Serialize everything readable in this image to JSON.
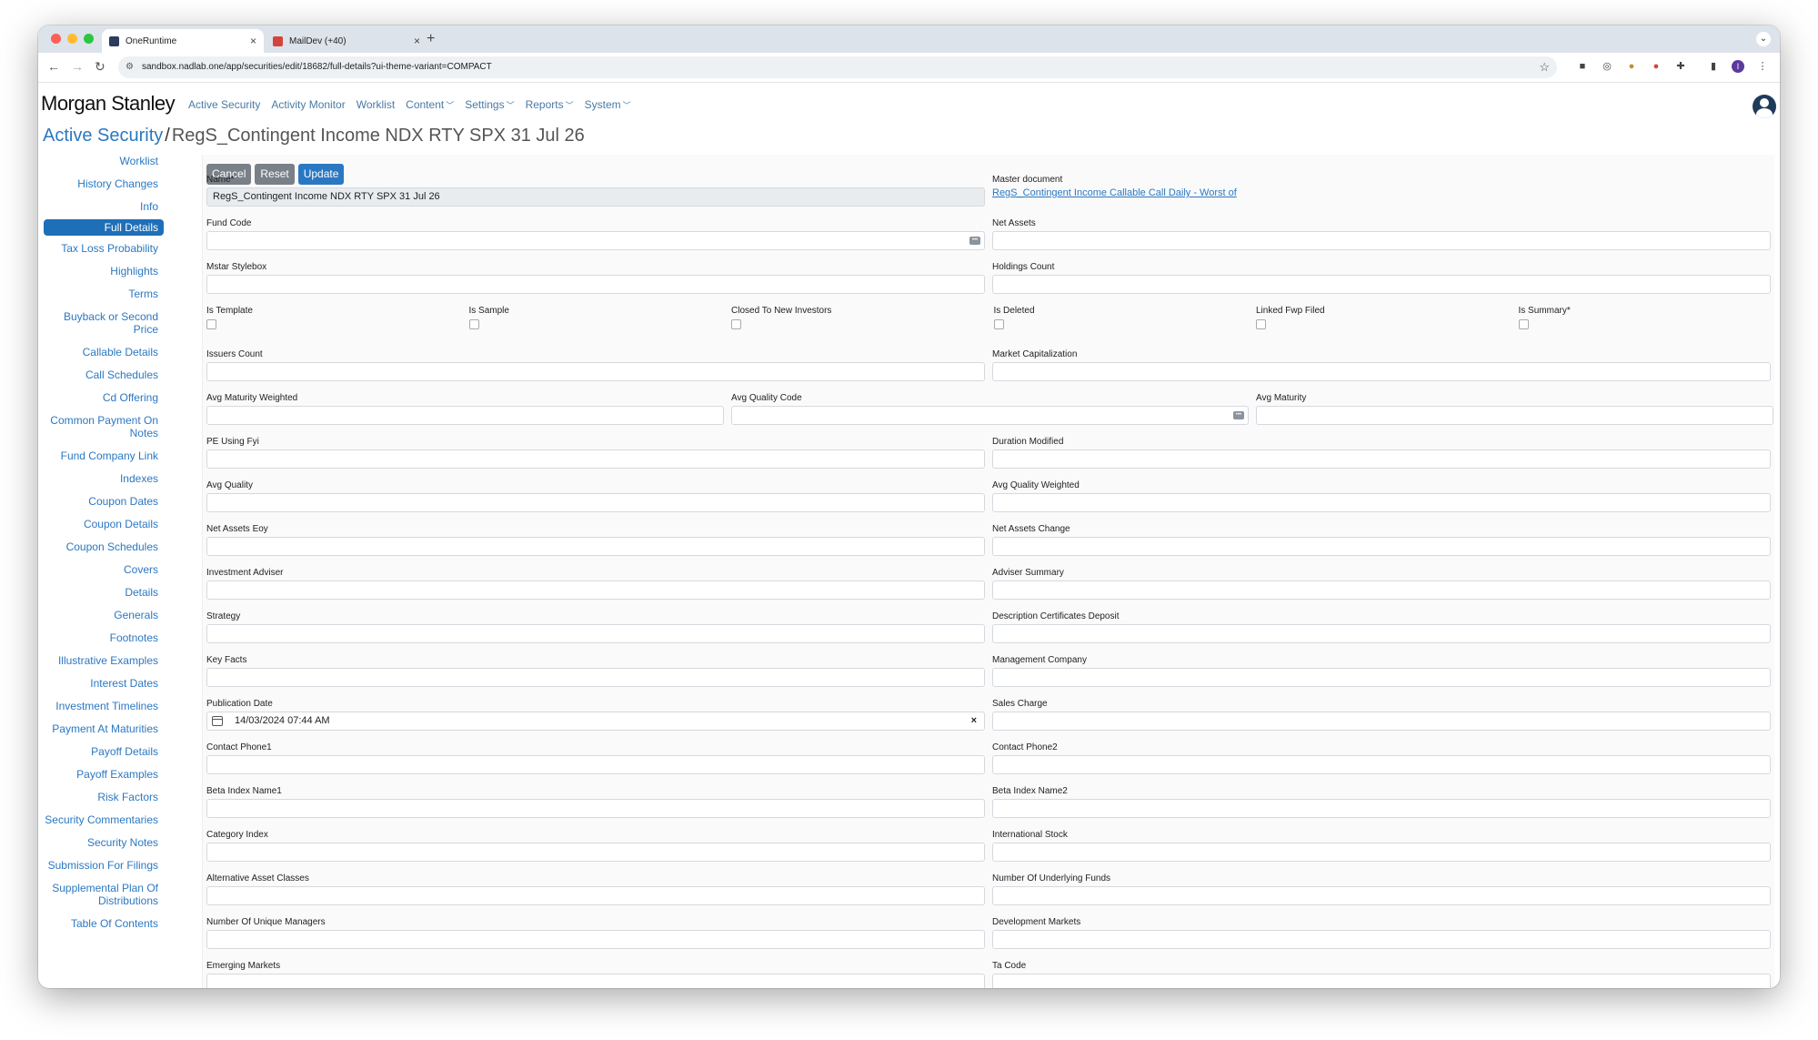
{
  "browser": {
    "tabs": [
      {
        "title": "OneRuntime",
        "favicon_color": "#2a3d5c"
      },
      {
        "title": "MailDev (+40)",
        "favicon_color": "#d3453a"
      }
    ],
    "url": "sandbox.nadlab.one/app/securities/edit/18682/full-details?ui-theme-variant=COMPACT"
  },
  "app": {
    "logo": "Morgan Stanley",
    "menu": [
      {
        "label": "Active Security",
        "dropdown": false
      },
      {
        "label": "Activity Monitor",
        "dropdown": false
      },
      {
        "label": "Worklist",
        "dropdown": false
      },
      {
        "label": "Content",
        "dropdown": true
      },
      {
        "label": "Settings",
        "dropdown": true
      },
      {
        "label": "Reports",
        "dropdown": true
      },
      {
        "label": "System",
        "dropdown": true
      }
    ]
  },
  "page": {
    "breadcrumb": "Active Security",
    "separator": "/",
    "title": "RegS_Contingent Income NDX RTY SPX 31 Jul 26"
  },
  "sidebar": {
    "items": [
      "Worklist",
      "History Changes",
      "Info",
      "Full Details",
      "Tax Loss Probability",
      "Highlights",
      "Terms",
      "Buyback or Second Price",
      "Callable Details",
      "Call Schedules",
      "Cd Offering",
      "Common Payment On Notes",
      "Fund Company Link",
      "Indexes",
      "Coupon Dates",
      "Coupon Details",
      "Coupon Schedules",
      "Covers",
      "Details",
      "Generals",
      "Footnotes",
      "Illustrative Examples",
      "Interest Dates",
      "Investment Timelines",
      "Payment At Maturities",
      "Payoff Details",
      "Payoff Examples",
      "Risk Factors",
      "Security Commentaries",
      "Security Notes",
      "Submission For Filings",
      "Supplemental Plan Of Distributions",
      "Table Of Contents"
    ],
    "active": "Full Details"
  },
  "toolbar": {
    "cancel": "Cancel",
    "reset": "Reset",
    "update": "Update"
  },
  "form": {
    "name_label": "Name*",
    "name_value": "RegS_Contingent Income NDX RTY SPX 31 Jul 26",
    "master_label": "Master document",
    "master_value": "RegS_Contingent Income Callable Call Daily - Worst of",
    "fund_code": "Fund Code",
    "net_assets": "Net Assets",
    "mstar": "Mstar Stylebox",
    "holdings": "Holdings Count",
    "checkboxes": [
      "Is Template",
      "Is Sample",
      "Closed To New Investors",
      "Is Deleted",
      "Linked Fwp Filed",
      "Is Summary*"
    ],
    "issuers": "Issuers Count",
    "market_cap": "Market Capitalization",
    "avg_mat_w": "Avg Maturity Weighted",
    "avg_qual_code": "Avg Quality Code",
    "avg_mat": "Avg Maturity",
    "pe": "PE Using Fyi",
    "duration": "Duration Modified",
    "avg_qual": "Avg Quality",
    "avg_qual_w": "Avg Quality Weighted",
    "na_eoy": "Net Assets Eoy",
    "na_change": "Net Assets Change",
    "inv_adviser": "Investment Adviser",
    "adv_summary": "Adviser Summary",
    "strategy": "Strategy",
    "desc_cert": "Description Certificates Deposit",
    "key_facts": "Key Facts",
    "mgmt_co": "Management Company",
    "pub_date": "Publication Date",
    "pub_date_value": "14/03/2024 07:44 AM",
    "sales_charge": "Sales Charge",
    "phone1": "Contact Phone1",
    "phone2": "Contact Phone2",
    "beta1": "Beta Index Name1",
    "beta2": "Beta Index Name2",
    "cat_index": "Category Index",
    "intl_stock": "International Stock",
    "alt_assets": "Alternative Asset Classes",
    "num_underlying": "Number Of Underlying Funds",
    "num_managers": "Number Of Unique Managers",
    "dev_markets": "Development Markets",
    "emerging": "Emerging Markets",
    "ta_code": "Ta Code"
  }
}
